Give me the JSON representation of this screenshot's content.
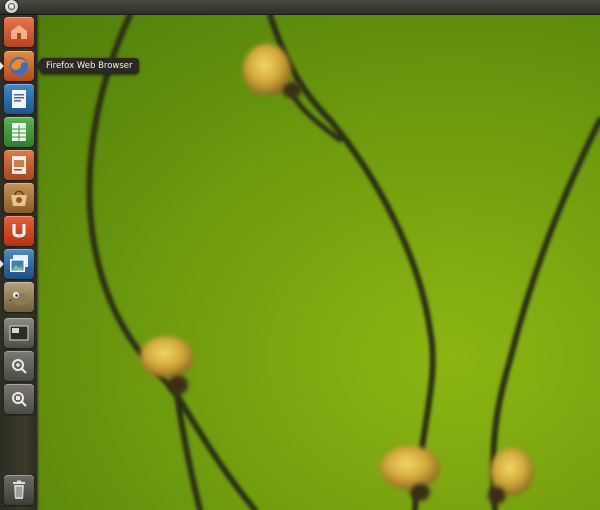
{
  "top_panel": {
    "menu_icon": "ubuntu-logo-icon"
  },
  "launcher": {
    "items": [
      {
        "name": "home-folder",
        "icon": "home-folder-icon",
        "color": "#d9633a",
        "running": false
      },
      {
        "name": "firefox",
        "icon": "firefox-icon",
        "color": "#c65a2a",
        "running": true
      },
      {
        "name": "writer",
        "icon": "document-icon",
        "color": "#2a6fb5",
        "running": false
      },
      {
        "name": "calc",
        "icon": "spreadsheet-icon",
        "color": "#3f9b3a",
        "running": false
      },
      {
        "name": "impress",
        "icon": "presentation-icon",
        "color": "#c75b2a",
        "running": false
      },
      {
        "name": "software-center",
        "icon": "shopping-bag-icon",
        "color": "#b07a3a",
        "running": false
      },
      {
        "name": "ubuntu-one",
        "icon": "ubuntu-one-icon",
        "color": "#d5482a",
        "running": false
      },
      {
        "name": "image-viewer",
        "icon": "photo-icon",
        "color": "#2d6aa5",
        "running": true
      },
      {
        "name": "gimp",
        "icon": "gimp-icon",
        "color": "#9a8a60",
        "running": false
      },
      {
        "name": "workspace-switcher",
        "icon": "workspaces-icon",
        "color": "#7a7a72",
        "running": false
      },
      {
        "name": "apps-lens",
        "icon": "apps-search-icon",
        "color": "#7a7a72",
        "running": false
      },
      {
        "name": "files-lens",
        "icon": "files-search-icon",
        "color": "#7a7a72",
        "running": false
      },
      {
        "name": "trash",
        "icon": "trash-icon",
        "color": "#6d6d66",
        "running": false
      }
    ]
  },
  "tooltip": {
    "text": "Firefox Web Browser"
  }
}
